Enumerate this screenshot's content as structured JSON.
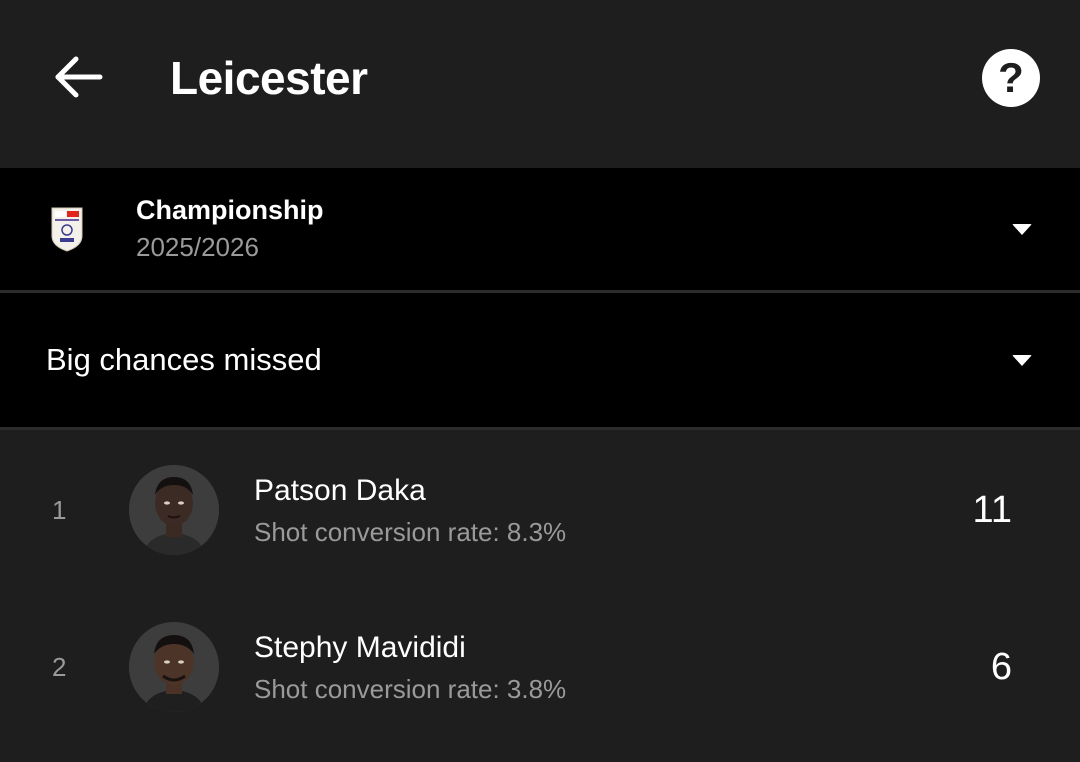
{
  "header": {
    "title": "Leicester",
    "back_icon": "arrow-left-icon",
    "help_icon": "question-mark-icon",
    "help_glyph": "?"
  },
  "league": {
    "name": "Championship",
    "season": "2025/2026",
    "logo_icon": "efl-championship-logo",
    "logo_text_top": "sky bet",
    "logo_text_bottom": "EFL"
  },
  "stat_selector": {
    "label": "Big chances missed"
  },
  "players": [
    {
      "rank": "1",
      "name": "Patson Daka",
      "subtitle": "Shot conversion rate: 8.3%",
      "value": "11"
    },
    {
      "rank": "2",
      "name": "Stephy Mavididi",
      "subtitle": "Shot conversion rate: 3.8%",
      "value": "6"
    }
  ],
  "colors": {
    "background": "#1e1e1e",
    "selector_background": "#000000",
    "text_primary": "#ffffff",
    "text_secondary": "#9a9a9a"
  }
}
